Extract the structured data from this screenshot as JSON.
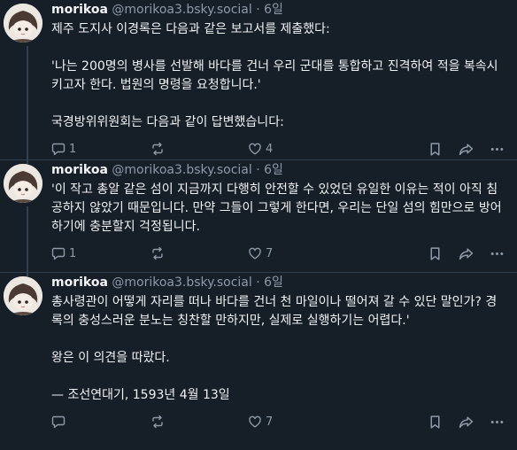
{
  "posts": [
    {
      "name": "morikoa",
      "handle": "@morikoa3.bsky.social",
      "sep": "·",
      "time": "6일",
      "paragraphs": [
        "제주 도지사 이경록은 다음과 같은 보고서를 제출했다:",
        "'나는 200명의 병사를 선발해 바다를 건너 우리 군대를 통합하고 진격하여 적을 복속시키고자 한다. 법원의 명령을 요청합니다.'",
        "국경방위위원회는 다음과 같이 답변했습니다:"
      ],
      "reply_count": "1",
      "repost_count": "",
      "like_count": "4"
    },
    {
      "name": "morikoa",
      "handle": "@morikoa3.bsky.social",
      "sep": "·",
      "time": "6일",
      "paragraphs": [
        "'이 작고 총알 같은 섬이 지금까지 다행히 안전할 수 있었던 유일한 이유는 적이 아직 침공하지 않았기 때문입니다. 만약 그들이 그렇게 한다면, 우리는 단일 섬의 힘만으로 방어하기에 충분할지 걱정됩니다."
      ],
      "reply_count": "1",
      "repost_count": "",
      "like_count": "7"
    },
    {
      "name": "morikoa",
      "handle": "@morikoa3.bsky.social",
      "sep": "·",
      "time": "6일",
      "paragraphs": [
        "총사령관이 어떻게 자리를 떠나 바다를 건너 천 마일이나 떨어져 갈 수 있단 말인가? 경록의 충성스러운 분노는 칭찬할 만하지만, 실제로 실행하기는 어렵다.'",
        "왕은 이 의견을 따랐다.",
        "— 조선연대기, 1593년 4월 13일"
      ],
      "reply_count": "",
      "repost_count": "",
      "like_count": "7"
    }
  ],
  "icons": {
    "reply": "speech-bubble-icon",
    "repost": "repost-arrows-icon",
    "like": "heart-icon",
    "bookmark": "bookmark-icon",
    "share": "share-arrow-icon",
    "more": "more-dots-icon"
  },
  "colors": {
    "background": "#161e27",
    "text": "#f1f3f5",
    "muted": "#8d9aa8",
    "divider": "#2e4052"
  }
}
